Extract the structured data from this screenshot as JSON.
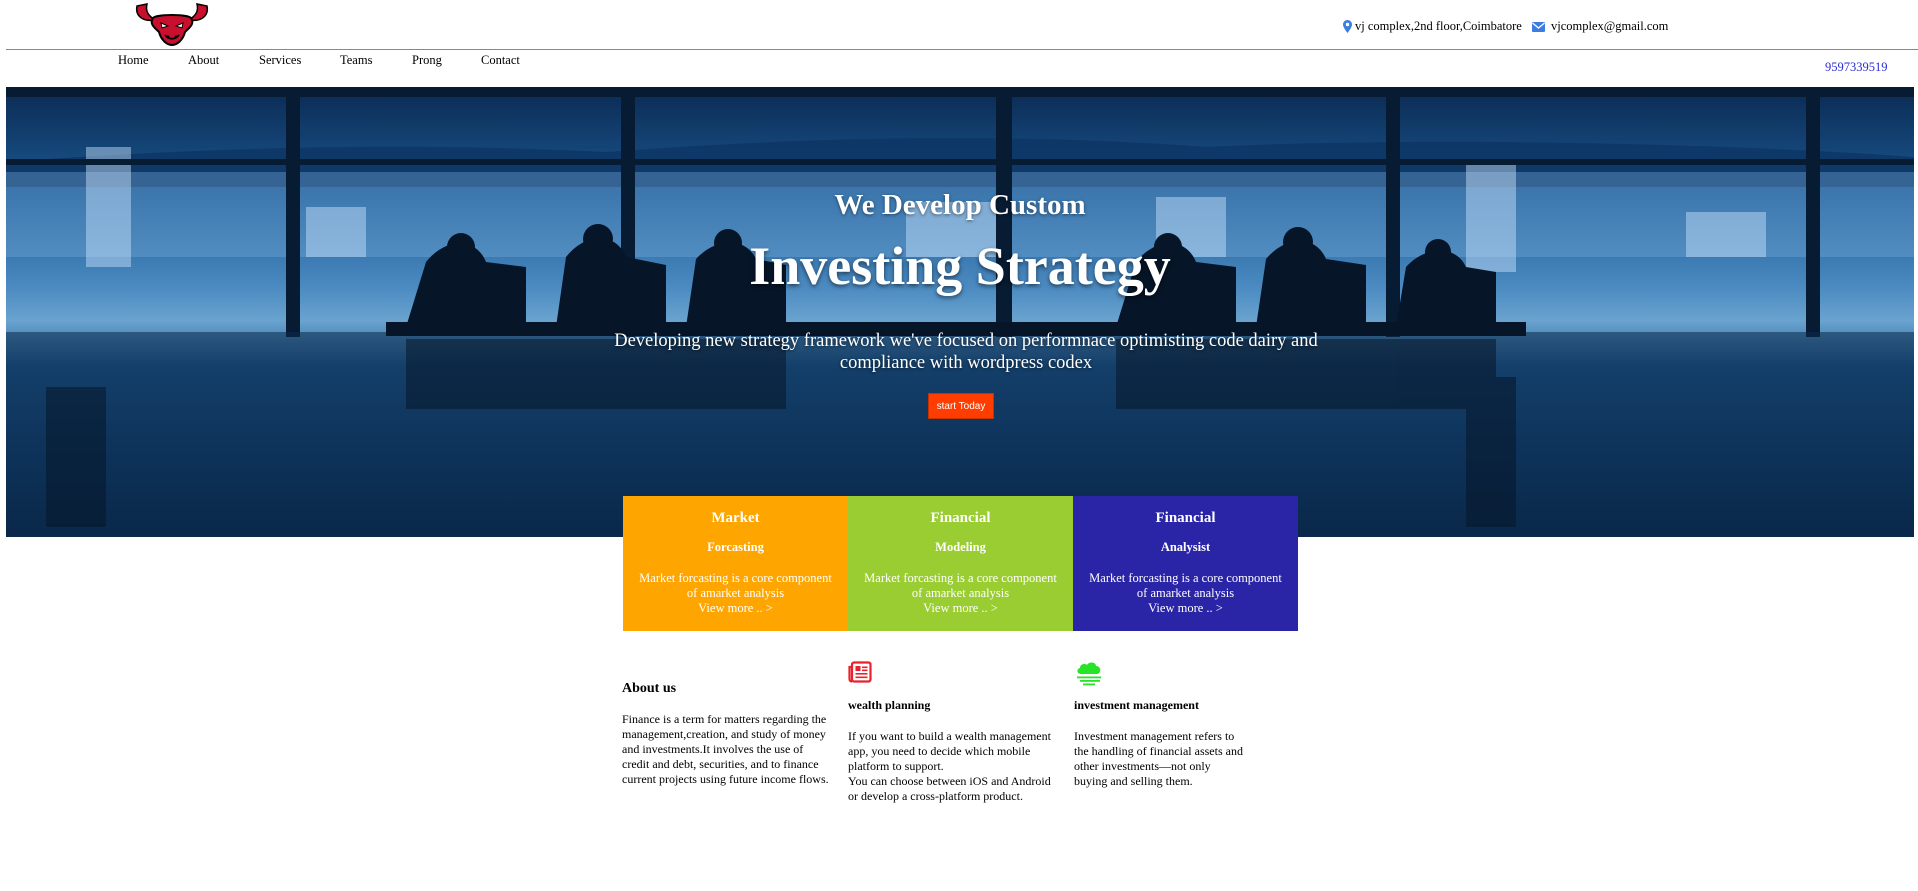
{
  "header": {
    "logo_icon": "bull-head-icon",
    "address": "vj complex,2nd floor,Coimbatore",
    "email": "vjcomplex@gmail.com",
    "phone": "9597339519"
  },
  "nav": {
    "items": [
      "Home",
      "About",
      "Services",
      "Teams",
      "Prong",
      "Contact"
    ]
  },
  "hero": {
    "subtitle": "We Develop Custom",
    "title": "Investing Strategy",
    "description": "Developing new strategy framework we've focused on performnace optimisting code dairy and compliance with wordpress codex",
    "button_label": "start Today",
    "button_color": "#ff3d00"
  },
  "cards": [
    {
      "title": "Market",
      "subtitle": "Forcasting",
      "text": "Market forcasting is a core component of amarket analysis",
      "more": "View more .. >",
      "color": "#ffa500"
    },
    {
      "title": "Financial",
      "subtitle": "Modeling",
      "text": "Market forcasting is a core component of amarket analysis",
      "more": "View more .. >",
      "color": "#9acd32"
    },
    {
      "title": "Financial",
      "subtitle": "Analysist",
      "text": "Market forcasting is a core component of amarket analysis",
      "more": "View more .. >",
      "color": "#2a24a6"
    }
  ],
  "about": {
    "heading": "About us",
    "text": "Finance is a term for matters regarding the management,creation, and study of money and investments.It involves the use of credit and debt, securities, and to finance current projects using future income flows."
  },
  "features": [
    {
      "icon": "newspaper-icon",
      "heading": "wealth planning",
      "text_1": "If you want to build a wealth management app, you need to decide which mobile platform to support.",
      "text_2": "You can choose between iOS and Android or develop a cross-platform product.",
      "icon_color": "#e8222d"
    },
    {
      "icon": "cloud-rain-icon",
      "heading": "investment management",
      "text_1": "Investment management refers to the handling of financial assets and other investments—not only buying and selling them.",
      "icon_color": "#27e427"
    }
  ]
}
